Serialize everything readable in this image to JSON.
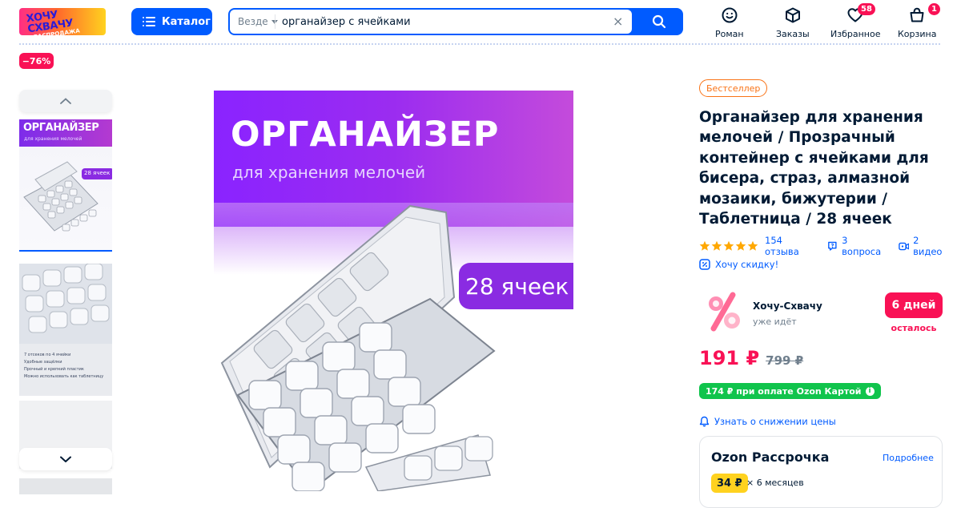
{
  "header": {
    "logo_line1": "ХОЧУ",
    "logo_line2": "СХВАЧУ",
    "logo_line3": "РАСПРОДАЖА",
    "catalog_label": "Каталог",
    "search_scope": "Везде",
    "search_query": "органайзер с ячейками",
    "nav": [
      {
        "label": "Роман",
        "icon": "profile-smile-icon"
      },
      {
        "label": "Заказы",
        "icon": "box-icon"
      },
      {
        "label": "Избранное",
        "icon": "heart-icon",
        "badge": "58"
      },
      {
        "label": "Корзина",
        "icon": "cart-icon",
        "badge": "1"
      }
    ]
  },
  "product": {
    "discount_badge": "−76%",
    "image_title": "ОРГАНАЙЗЕР",
    "image_subtitle": "для хранения мелочей",
    "image_badge": "28 ячеек",
    "thumbs": [
      {
        "title": "ОРГАНАЙЗЕР",
        "subtitle": "для хранения мелочей",
        "badge": "28 ячеек"
      },
      {
        "features": [
          "7 отсеков по 4 ячейки",
          "Удобные защёлки",
          "Прочный и крепкий пластик",
          "Можно использовать как таблетницу"
        ]
      }
    ],
    "bestseller_label": "Бестселлер",
    "title": "Органайзер для хранения мелочей / Прозрачный контейнер с ячейками для бисера, страз, алмазной мозаики, бижутерии / Таблетница / 28 ячеек",
    "rating_stars": 5,
    "reviews": "154 отзыва",
    "questions": "3 вопроса",
    "videos": "2 видео",
    "want_discount": "Хочу скидку!",
    "promo": {
      "name": "Хочу-Схвачу",
      "status": "уже идёт",
      "days": "6 дней",
      "left": "осталось"
    },
    "price_now": "191 ₽",
    "price_old": "799 ₽",
    "ozon_card_price": "174 ₽ при оплате Ozon Картой",
    "notify_label": "Узнать о снижении цены",
    "installment": {
      "title": "Ozon Рассрочка",
      "more": "Подробнее",
      "amount": "34 ₽",
      "months": "× 6 месяцев"
    }
  },
  "colors": {
    "accent": "#005bff",
    "sale": "#f91155",
    "green": "#10c44c",
    "bestseller": "#f97316",
    "star": "#ffa800"
  }
}
